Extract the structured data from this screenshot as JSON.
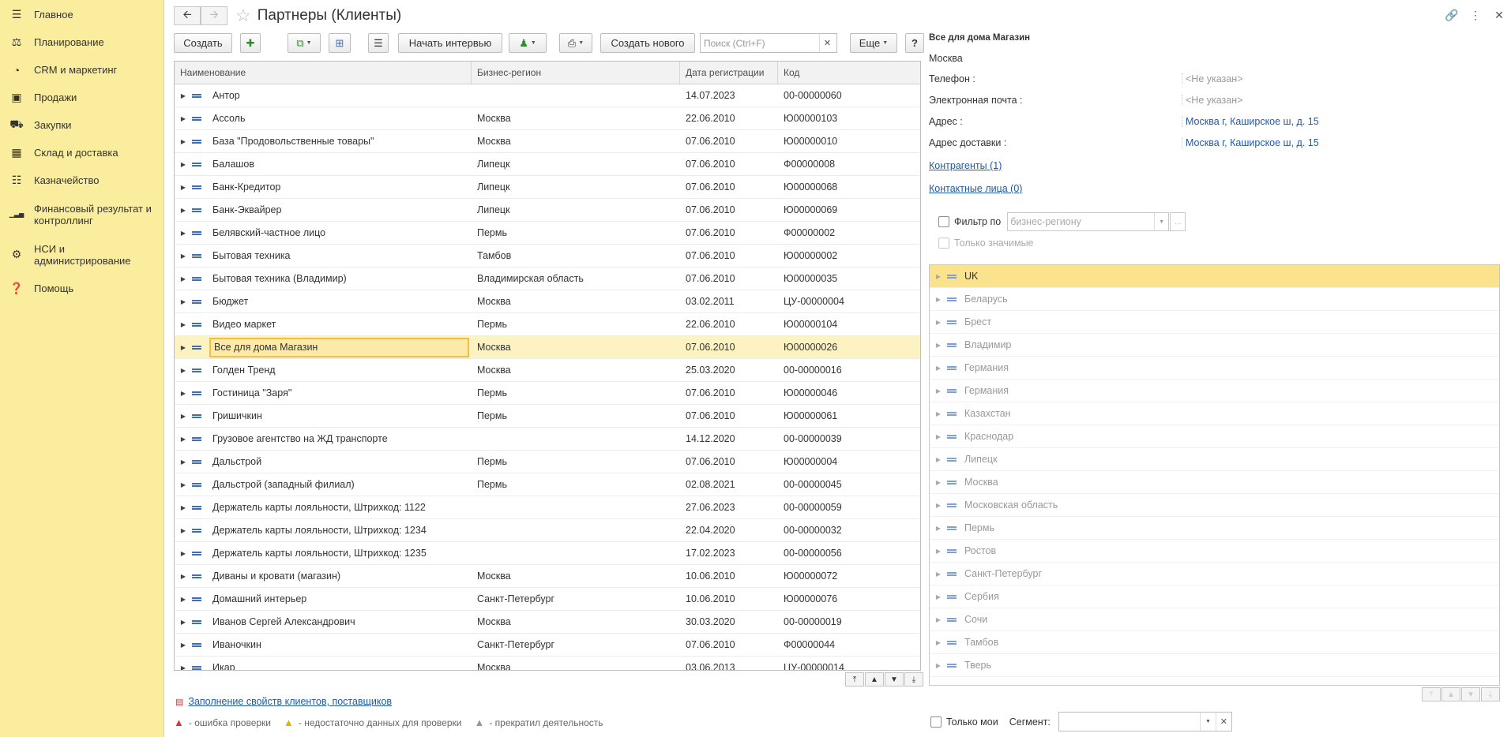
{
  "sidebar": {
    "items": [
      {
        "icon": "menu-icon",
        "label": "Главное"
      },
      {
        "icon": "planning-icon",
        "label": "Планирование"
      },
      {
        "icon": "pie-chart-icon",
        "label": "CRM и маркетинг"
      },
      {
        "icon": "bag-icon",
        "label": "Продажи"
      },
      {
        "icon": "cart-icon",
        "label": "Закупки"
      },
      {
        "icon": "warehouse-icon",
        "label": "Склад и доставка"
      },
      {
        "icon": "treasury-icon",
        "label": "Казначейство"
      },
      {
        "icon": "bar-chart-icon",
        "label": "Финансовый результат и контроллинг"
      },
      {
        "icon": "gear-icon",
        "label": "НСИ и администрирование"
      },
      {
        "icon": "help-icon",
        "label": "Помощь"
      }
    ]
  },
  "header": {
    "title": "Партнеры (Клиенты)"
  },
  "toolbar": {
    "create": "Создать",
    "start_interview": "Начать интервью",
    "create_new": "Создать нового",
    "search_placeholder": "Поиск (Ctrl+F)",
    "more": "Еще",
    "help": "?"
  },
  "table": {
    "columns": [
      "Наименование",
      "Бизнес-регион",
      "Дата регистрации",
      "Код"
    ],
    "selected_index": 11,
    "rows": [
      [
        "Антор",
        "",
        "14.07.2023",
        "00-00000060"
      ],
      [
        "Ассоль",
        "Москва",
        "22.06.2010",
        "Ю00000103"
      ],
      [
        "База \"Продовольственные товары\"",
        "Москва",
        "07.06.2010",
        "Ю00000010"
      ],
      [
        "Балашов",
        "Липецк",
        "07.06.2010",
        "Ф00000008"
      ],
      [
        "Банк-Кредитор",
        "Липецк",
        "07.06.2010",
        "Ю00000068"
      ],
      [
        "Банк-Эквайрер",
        "Липецк",
        "07.06.2010",
        "Ю00000069"
      ],
      [
        "Белявский-частное лицо",
        "Пермь",
        "07.06.2010",
        "Ф00000002"
      ],
      [
        "Бытовая техника",
        "Тамбов",
        "07.06.2010",
        "Ю00000002"
      ],
      [
        "Бытовая техника (Владимир)",
        "Владимирская область",
        "07.06.2010",
        "Ю00000035"
      ],
      [
        "Бюджет",
        "Москва",
        "03.02.2011",
        "ЦУ-00000004"
      ],
      [
        "Видео маркет",
        "Пермь",
        "22.06.2010",
        "Ю00000104"
      ],
      [
        "Все для дома Магазин",
        "Москва",
        "07.06.2010",
        "Ю00000026"
      ],
      [
        "Голден Тренд",
        "Москва",
        "25.03.2020",
        "00-00000016"
      ],
      [
        "Гостиница \"Заря\"",
        "Пермь",
        "07.06.2010",
        "Ю00000046"
      ],
      [
        "Гришичкин",
        "Пермь",
        "07.06.2010",
        "Ю00000061"
      ],
      [
        "Грузовое агентство на ЖД транспорте",
        "",
        "14.12.2020",
        "00-00000039"
      ],
      [
        "Дальстрой",
        "Пермь",
        "07.06.2010",
        "Ю00000004"
      ],
      [
        "Дальстрой (западный филиал)",
        "Пермь",
        "02.08.2021",
        "00-00000045"
      ],
      [
        "Держатель карты лояльности, Штрихкод: 1122",
        "",
        "27.06.2023",
        "00-00000059"
      ],
      [
        "Держатель карты лояльности, Штрихкод: 1234",
        "",
        "22.04.2020",
        "00-00000032"
      ],
      [
        "Держатель карты лояльности, Штрихкод: 1235",
        "",
        "17.02.2023",
        "00-00000056"
      ],
      [
        "Диваны и кровати (магазин)",
        "Москва",
        "10.06.2010",
        "Ю00000072"
      ],
      [
        "Домашний интерьер",
        "Санкт-Петербург",
        "10.06.2010",
        "Ю00000076"
      ],
      [
        "Иванов Сергей Александрович",
        "Москва",
        "30.03.2020",
        "00-00000019"
      ],
      [
        "Иваночкин",
        "Санкт-Петербург",
        "07.06.2010",
        "Ф00000044"
      ],
      [
        "Икар",
        "Москва",
        "03.06.2013",
        "ЦУ-00000014"
      ]
    ]
  },
  "footer": {
    "fill_link": "Заполнение свойств клиентов, поставщиков",
    "legend_error": "- ошибка проверки",
    "legend_insufficient": "- недостаточно данных для проверки",
    "legend_stopped": "- прекратил деятельность"
  },
  "details": {
    "name": "Все для дома Магазин",
    "city": "Москва",
    "phone_label": "Телефон :",
    "phone_value": "<Не указан>",
    "email_label": "Электронная почта :",
    "email_value": "<Не указан>",
    "address_label": "Адрес :",
    "address_value": "Москва г, Каширское ш, д. 15",
    "delivery_label": "Адрес доставки :",
    "delivery_value": "Москва г, Каширское ш, д. 15",
    "counterparties_link": "Контрагенты (1)",
    "contacts_link": "Контактные лица (0)"
  },
  "filter": {
    "label": "Фильтр по",
    "value": "бизнес-региону",
    "only_significant": "Только значимые"
  },
  "regions": {
    "selected_index": 0,
    "items": [
      "UK",
      "Беларусь",
      "Брест",
      "Владимир",
      "Германия",
      "Германия",
      "Казахстан",
      "Краснодар",
      "Липецк",
      "Москва",
      "Московская область",
      "Пермь",
      "Ростов",
      "Санкт-Петербург",
      "Сербия",
      "Сочи",
      "Тамбов",
      "Тверь"
    ]
  },
  "bottom": {
    "only_mine": "Только мои",
    "segment_label": "Сегмент:",
    "segment_value": ""
  }
}
